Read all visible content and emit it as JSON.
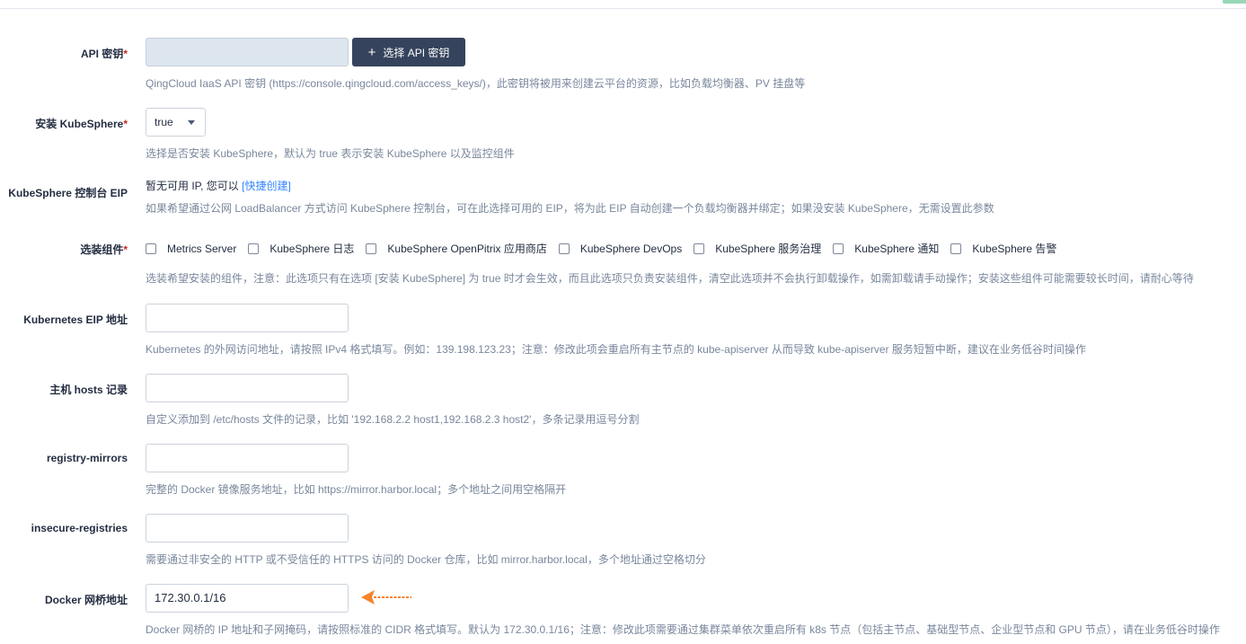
{
  "fields": {
    "api_key": {
      "label": "API 密钥",
      "required_mark": "*",
      "value": "",
      "button_label": "选择 API 密钥",
      "button_icon": "plus-icon",
      "description": "QingCloud IaaS API 密钥 (https://console.qingcloud.com/access_keys/)，此密钥将被用来创建云平台的资源，比如负载均衡器、PV 挂盘等"
    },
    "install_kubesphere": {
      "label": "安装 KubeSphere",
      "required_mark": "*",
      "selected": "true",
      "description": "选择是否安装 KubeSphere，默认为 true 表示安装 KubeSphere 以及监控组件"
    },
    "console_eip": {
      "label": "KubeSphere 控制台 EIP",
      "text": "暂无可用 IP, 您可以 ",
      "link_label": "[快捷创建]",
      "description": "如果希望通过公网 LoadBalancer 方式访问 KubeSphere 控制台，可在此选择可用的 EIP，将为此 EIP 自动创建一个负载均衡器并绑定；如果没安装 KubeSphere，无需设置此参数"
    },
    "components": {
      "label": "选装组件",
      "required_mark": "*",
      "options": [
        {
          "label": "Metrics Server",
          "checked": false
        },
        {
          "label": "KubeSphere 日志",
          "checked": false
        },
        {
          "label": "KubeSphere OpenPitrix 应用商店",
          "checked": false
        },
        {
          "label": "KubeSphere DevOps",
          "checked": false
        },
        {
          "label": "KubeSphere 服务治理",
          "checked": false
        },
        {
          "label": "KubeSphere 通知",
          "checked": false
        },
        {
          "label": "KubeSphere 告警",
          "checked": false
        }
      ],
      "description": "选装希望安装的组件，注意：此选项只有在选项 [安装 KubeSphere] 为 true 时才会生效，而且此选项只负责安装组件，清空此选项并不会执行卸载操作，如需卸载请手动操作；安装这些组件可能需要较长时间，请耐心等待"
    },
    "k8s_eip": {
      "label": "Kubernetes EIP 地址",
      "value": "",
      "description": "Kubernetes 的外网访问地址，请按照 IPv4 格式填写。例如：139.198.123.23；注意：修改此项会重启所有主节点的 kube-apiserver 从而导致 kube-apiserver 服务短暂中断，建议在业务低谷时间操作"
    },
    "hosts": {
      "label": "主机 hosts 记录",
      "value": "",
      "description": "自定义添加到 /etc/hosts 文件的记录，比如 '192.168.2.2 host1,192.168.2.3 host2'，多条记录用逗号分割"
    },
    "registry_mirrors": {
      "label": "registry-mirrors",
      "value": "",
      "description": "完整的 Docker 镜像服务地址，比如 https://mirror.harbor.local；多个地址之间用空格隔开"
    },
    "insecure_registries": {
      "label": "insecure-registries",
      "value": "",
      "description": "需要通过非安全的 HTTP 或不受信任的 HTTPS 访问的 Docker 仓库，比如 mirror.harbor.local，多个地址通过空格切分"
    },
    "docker_bridge": {
      "label": "Docker 网桥地址",
      "value": "172.30.0.1/16",
      "description": "Docker 网桥的 IP 地址和子网掩码，请按照标准的 CIDR 格式填写。默认为 172.30.0.1/16；注意：修改此项需要通过集群菜单依次重启所有 k8s 节点（包括主节点、基础型节点、企业型节点和 GPU 节点），请在业务低谷时操作"
    }
  },
  "annotation": {
    "icon": "arrow-left-icon",
    "color": "#f5832a"
  },
  "colors": {
    "accent_link": "#3385ff",
    "required": "#ca2621",
    "dark_button": "#36435c"
  }
}
